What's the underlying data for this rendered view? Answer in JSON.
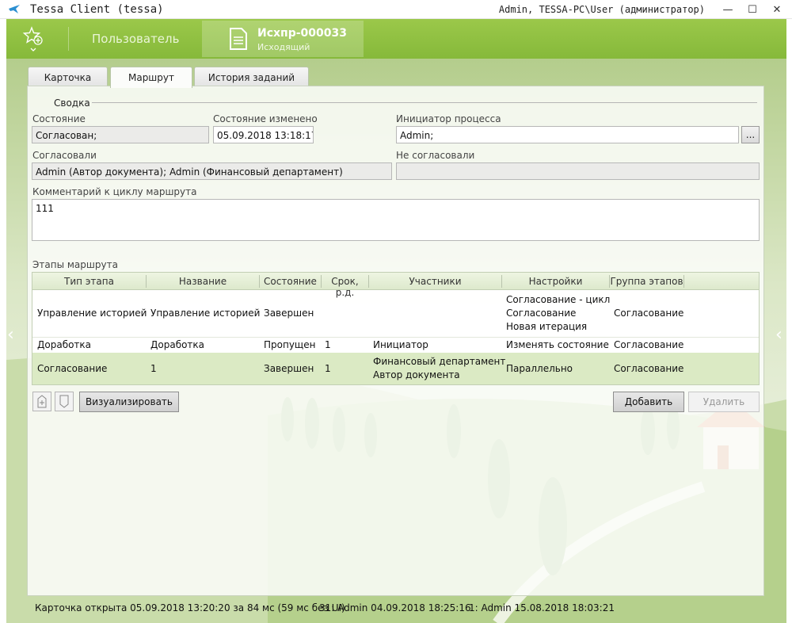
{
  "window": {
    "title": "Tessa Client (tessa)",
    "user": "Admin, TESSA-PC\\User (администратор)",
    "minimize_glyph": "—",
    "maximize_glyph": "☐",
    "close_glyph": "✕"
  },
  "header": {
    "user_tab": "Пользователь",
    "doc_number": "Исхпр-000033",
    "doc_type": "Исходящий"
  },
  "tabs": [
    "Карточка",
    "Маршрут",
    "История заданий"
  ],
  "summary": {
    "section_title": "Сводка",
    "state_label": "Состояние",
    "state_value": "Согласован;",
    "changed_label": "Состояние изменено",
    "changed_value": "05.09.2018  13:18:17",
    "initiator_label": "Инициатор процесса",
    "initiator_value": "Admin;",
    "initiator_button": "...",
    "approved_label": "Согласовали",
    "approved_value": "Admin (Автор документа); Admin (Финансовый департамент)",
    "not_approved_label": "Не согласовали",
    "not_approved_value": "",
    "comment_label": "Комментарий к циклу маршрута",
    "comment_value": "111"
  },
  "stages": {
    "label": "Этапы маршрута",
    "columns": [
      "Тип этапа",
      "Название",
      "Состояние",
      "Срок, р.д.",
      "Участники",
      "Настройки",
      "Группа этапов"
    ],
    "rows": [
      {
        "type": "Управление историей",
        "name": "Управление историей",
        "state": "Завершен",
        "term": "",
        "participants": [
          "",
          ""
        ],
        "settings": [
          "Согласование - цикл",
          "Согласование",
          "Новая итерация"
        ],
        "group": "Согласование"
      },
      {
        "type": "Доработка",
        "name": "Доработка",
        "state": "Пропущен",
        "term": "1",
        "participants": [
          "Инициатор",
          ""
        ],
        "settings": [
          "Изменять состояние",
          "",
          ""
        ],
        "group": "Согласование"
      },
      {
        "type": "Согласование",
        "name": "1",
        "state": "Завершен",
        "term": "1",
        "participants": [
          "Финансовый департамент",
          "Автор документа"
        ],
        "settings": [
          "Параллельно",
          "",
          ""
        ],
        "group": "Согласование"
      }
    ]
  },
  "buttons": {
    "visualize": "Визуализировать",
    "add": "Добавить",
    "delete": "Удалить"
  },
  "status": {
    "opened": "Карточка открыта 05.09.2018 13:20:20 за 84 мс (59 мс без UI)",
    "version1": "31:  Admin  04.09.2018 18:25:16",
    "version2": "1:  Admin  15.08.2018 18:03:21"
  }
}
